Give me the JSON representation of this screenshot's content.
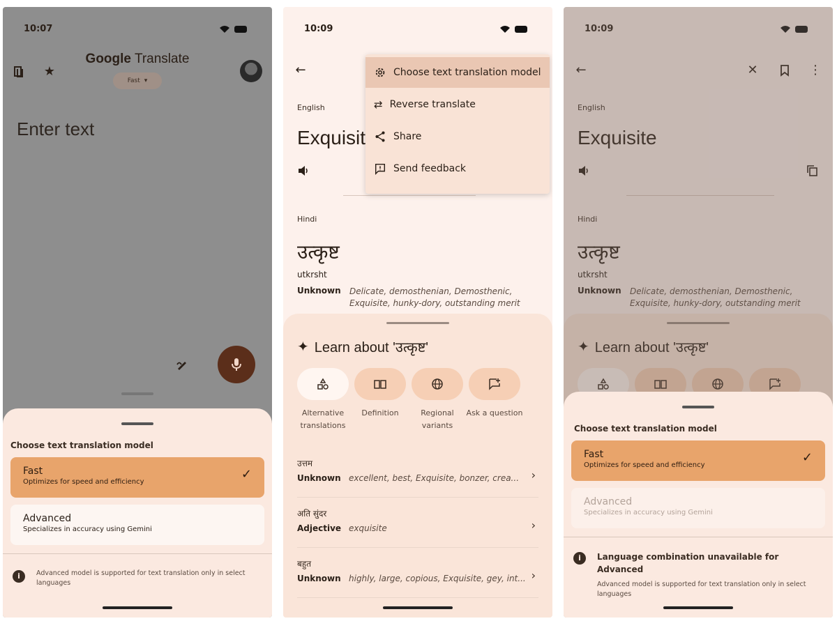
{
  "status": {
    "time_p1": "10:07",
    "time_p2": "10:09",
    "time_p3": "10:09"
  },
  "panel1": {
    "brand_google": "Google",
    "brand_translate": "Translate",
    "speed_label": "Fast",
    "input_placeholder": "Enter text"
  },
  "model_sheet": {
    "title": "Choose text translation model",
    "fast_title": "Fast",
    "fast_desc": "Optimizes for speed and efficiency",
    "advanced_title": "Advanced",
    "advanced_desc": "Specializes in accuracy using Gemini",
    "note": "Advanced model is supported for text translation only in select languages",
    "warning_title": "Language combination unavailable for Advanced"
  },
  "word_view": {
    "source_lang": "English",
    "source_word": "Exquisite",
    "target_lang": "Hindi",
    "target_word": "उत्कृष्ट",
    "transliteration": "utkrsht",
    "pos": "Unknown",
    "synonyms": "Delicate, demosthenian, Demosthenic, Exquisite, hunky-dory, outstanding merit"
  },
  "menu": {
    "items": [
      "Choose text translation model",
      "Reverse translate",
      "Share",
      "Send feedback"
    ]
  },
  "learn": {
    "title": "Learn about 'उत्कृष्ट'",
    "chips": [
      "Alternative translations",
      "Definition",
      "Regional variants",
      "Ask a question"
    ]
  },
  "alternatives": [
    {
      "word": "उत्तम",
      "pos": "Unknown",
      "gloss": "excellent, best, Exquisite, bonzer, crea..."
    },
    {
      "word": "अति सुंदर",
      "pos": "Adjective",
      "gloss": "exquisite"
    },
    {
      "word": "बहुत",
      "pos": "Unknown",
      "gloss": "highly, large, copious, Exquisite, gey, int..."
    }
  ],
  "colors": {
    "accent": "#e8a46b",
    "mic": "#5b2e1a",
    "sheet": "#fbe9e0"
  }
}
